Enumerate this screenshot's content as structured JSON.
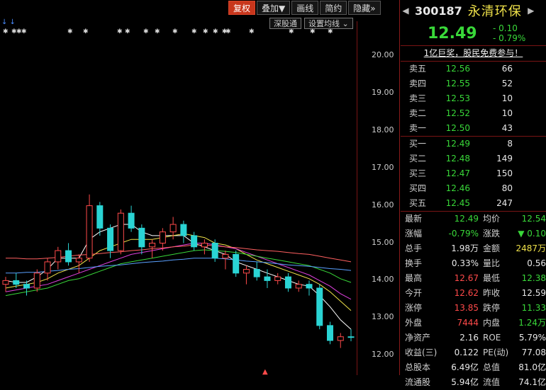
{
  "toolbar": {
    "items": [
      "复权",
      "叠加▼",
      "画线",
      "简约",
      "隐藏»"
    ],
    "active_index": 0
  },
  "chart_buttons": [
    "深股通",
    "设置均线"
  ],
  "chart_buttons_chevron": "⌄",
  "y_axis_ticks": [
    "20.00",
    "19.00",
    "18.00",
    "17.00",
    "16.00",
    "15.00",
    "14.00",
    "13.00",
    "12.00"
  ],
  "chart_data": {
    "type": "candlestick",
    "title": "",
    "ylim": [
      11.8,
      20.4
    ],
    "note_markers": "✱",
    "candles": [
      [
        13.9,
        14.1,
        13.7,
        14.0
      ],
      [
        14.0,
        14.2,
        13.8,
        13.9
      ],
      [
        13.9,
        14.0,
        13.6,
        13.8
      ],
      [
        13.8,
        14.3,
        13.7,
        14.2
      ],
      [
        14.2,
        14.6,
        14.0,
        14.5
      ],
      [
        14.5,
        14.9,
        14.3,
        14.8
      ],
      [
        14.8,
        15.0,
        14.4,
        14.5
      ],
      [
        14.5,
        14.7,
        14.2,
        14.6
      ],
      [
        14.6,
        16.3,
        14.5,
        16.0
      ],
      [
        16.0,
        16.1,
        15.2,
        15.4
      ],
      [
        15.4,
        15.5,
        14.6,
        14.8
      ],
      [
        14.8,
        15.9,
        14.7,
        15.8
      ],
      [
        15.8,
        16.0,
        15.3,
        15.4
      ],
      [
        15.4,
        15.5,
        14.7,
        14.9
      ],
      [
        14.9,
        15.1,
        14.6,
        15.0
      ],
      [
        15.0,
        15.4,
        14.8,
        15.3
      ],
      [
        15.3,
        15.7,
        15.1,
        15.5
      ],
      [
        15.5,
        15.6,
        15.0,
        15.2
      ],
      [
        15.2,
        15.3,
        14.8,
        14.9
      ],
      [
        14.9,
        15.1,
        14.7,
        15.0
      ],
      [
        15.0,
        15.1,
        14.5,
        14.6
      ],
      [
        14.6,
        14.8,
        14.3,
        14.7
      ],
      [
        14.7,
        14.8,
        14.1,
        14.2
      ],
      [
        14.2,
        14.4,
        13.9,
        14.3
      ],
      [
        14.3,
        14.5,
        14.0,
        14.1
      ],
      [
        14.1,
        14.3,
        13.8,
        14.0
      ],
      [
        14.0,
        14.2,
        13.9,
        14.1
      ],
      [
        14.1,
        14.2,
        13.7,
        13.8
      ],
      [
        13.8,
        14.0,
        13.7,
        13.9
      ],
      [
        13.9,
        14.0,
        13.6,
        13.8
      ],
      [
        13.8,
        13.9,
        12.7,
        12.8
      ],
      [
        12.8,
        12.9,
        12.3,
        12.4
      ],
      [
        12.4,
        12.6,
        12.2,
        12.5
      ],
      [
        12.5,
        12.7,
        12.38,
        12.49
      ]
    ],
    "ma_lines": [
      {
        "color": "#ffffff",
        "values": [
          14.0,
          13.95,
          13.95,
          14.1,
          14.3,
          14.6,
          14.6,
          14.6,
          15.1,
          15.3,
          15.4,
          15.5,
          15.5,
          15.3,
          15.2,
          15.2,
          15.2,
          15.2,
          15.0,
          14.9,
          14.8,
          14.7,
          14.5,
          14.4,
          14.3,
          14.2,
          14.1,
          14.0,
          13.9,
          13.85,
          13.6,
          13.3,
          12.95,
          12.7
        ]
      },
      {
        "color": "#f0e24a",
        "values": [
          13.8,
          13.85,
          13.9,
          13.95,
          14.05,
          14.2,
          14.3,
          14.4,
          14.6,
          14.8,
          14.9,
          15.0,
          15.1,
          15.1,
          15.1,
          15.15,
          15.2,
          15.25,
          15.2,
          15.15,
          15.0,
          14.95,
          14.85,
          14.7,
          14.55,
          14.45,
          14.35,
          14.25,
          14.15,
          14.05,
          13.9,
          13.7,
          13.45,
          13.2
        ]
      },
      {
        "color": "#e040e0",
        "values": [
          13.7,
          13.75,
          13.8,
          13.85,
          13.9,
          14.0,
          14.1,
          14.2,
          14.3,
          14.4,
          14.5,
          14.6,
          14.7,
          14.75,
          14.8,
          14.85,
          14.9,
          14.95,
          15.0,
          15.0,
          14.95,
          14.9,
          14.85,
          14.75,
          14.65,
          14.55,
          14.45,
          14.35,
          14.25,
          14.15,
          14.0,
          13.85,
          13.65,
          13.5
        ]
      },
      {
        "color": "#39d839",
        "values": [
          13.6,
          13.65,
          13.7,
          13.75,
          13.8,
          13.9,
          14.0,
          14.05,
          14.15,
          14.25,
          14.35,
          14.45,
          14.5,
          14.55,
          14.6,
          14.65,
          14.7,
          14.75,
          14.8,
          14.82,
          14.8,
          14.78,
          14.75,
          14.7,
          14.65,
          14.6,
          14.55,
          14.5,
          14.45,
          14.4,
          14.3,
          14.2,
          14.05,
          13.95
        ]
      },
      {
        "color": "#5aa0ff",
        "values": [
          14.2,
          14.2,
          14.22,
          14.22,
          14.25,
          14.27,
          14.3,
          14.32,
          14.35,
          14.38,
          14.4,
          14.42,
          14.45,
          14.48,
          14.5,
          14.52,
          14.55,
          14.57,
          14.6,
          14.6,
          14.6,
          14.58,
          14.55,
          14.52,
          14.5,
          14.48,
          14.45,
          14.42,
          14.4,
          14.38,
          14.35,
          14.32,
          14.3,
          14.27
        ]
      },
      {
        "color": "#ff6060",
        "values": [
          14.6,
          14.6,
          14.58,
          14.58,
          14.6,
          14.62,
          14.65,
          14.68,
          14.7,
          14.72,
          14.75,
          14.77,
          14.8,
          14.82,
          14.85,
          14.87,
          14.9,
          14.92,
          14.95,
          14.95,
          14.93,
          14.9,
          14.88,
          14.85,
          14.82,
          14.8,
          14.78,
          14.75,
          14.72,
          14.7,
          14.65,
          14.6,
          14.55,
          14.5
        ]
      }
    ]
  },
  "quote": {
    "code": "300187",
    "name": "永清环保",
    "price": "12.49",
    "change": "- 0.10",
    "change_pct": "- 0.79%",
    "ad_text": "1亿巨奖，股民免费参与！",
    "sell": [
      {
        "label": "卖五",
        "price": "12.56",
        "vol": "66"
      },
      {
        "label": "卖四",
        "price": "12.55",
        "vol": "52"
      },
      {
        "label": "卖三",
        "price": "12.53",
        "vol": "10"
      },
      {
        "label": "卖二",
        "price": "12.52",
        "vol": "10"
      },
      {
        "label": "卖一",
        "price": "12.50",
        "vol": "43"
      }
    ],
    "buy": [
      {
        "label": "买一",
        "price": "12.49",
        "vol": "8"
      },
      {
        "label": "买二",
        "price": "12.48",
        "vol": "149"
      },
      {
        "label": "买三",
        "price": "12.47",
        "vol": "150"
      },
      {
        "label": "买四",
        "price": "12.46",
        "vol": "80"
      },
      {
        "label": "买五",
        "price": "12.45",
        "vol": "247"
      }
    ],
    "stats": [
      {
        "l1": "最新",
        "v1": "12.49",
        "c1": "g",
        "l2": "均价",
        "v2": "12.54",
        "c2": "g"
      },
      {
        "l1": "涨幅",
        "v1": "-0.79%",
        "c1": "g",
        "l2": "涨跌",
        "v2": "▼ 0.10",
        "c2": "g"
      },
      {
        "l1": "总手",
        "v1": "1.98万",
        "c1": "w",
        "l2": "金额",
        "v2": "2487万",
        "c2": "y"
      },
      {
        "l1": "换手",
        "v1": "0.33%",
        "c1": "w",
        "l2": "量比",
        "v2": "0.56",
        "c2": "w"
      },
      {
        "l1": "最高",
        "v1": "12.67",
        "c1": "r",
        "l2": "最低",
        "v2": "12.38",
        "c2": "g"
      },
      {
        "l1": "今开",
        "v1": "12.62",
        "c1": "r",
        "l2": "昨收",
        "v2": "12.59",
        "c2": "w"
      },
      {
        "l1": "涨停",
        "v1": "13.85",
        "c1": "r",
        "l2": "跌停",
        "v2": "11.33",
        "c2": "g"
      },
      {
        "l1": "外盘",
        "v1": "7444",
        "c1": "r",
        "l2": "内盘",
        "v2": "1.24万",
        "c2": "g"
      },
      {
        "l1": "净资产",
        "v1": "2.16",
        "c1": "w",
        "l2": "ROE",
        "v2": "5.79%",
        "c2": "w"
      },
      {
        "l1": "收益(三)",
        "v1": "0.122",
        "c1": "w",
        "l2": "PE(动)",
        "v2": "77.08",
        "c2": "w"
      },
      {
        "l1": "总股本",
        "v1": "6.49亿",
        "c1": "w",
        "l2": "总值",
        "v2": "81.0亿",
        "c2": "w"
      },
      {
        "l1": "流通股",
        "v1": "5.94亿",
        "c1": "w",
        "l2": "流值",
        "v2": "74.1亿",
        "c2": "w"
      }
    ]
  },
  "colors": {
    "up": "#ff4a4a",
    "down": "#2ad4d4",
    "green": "#39d839",
    "border": "#7a1414"
  }
}
